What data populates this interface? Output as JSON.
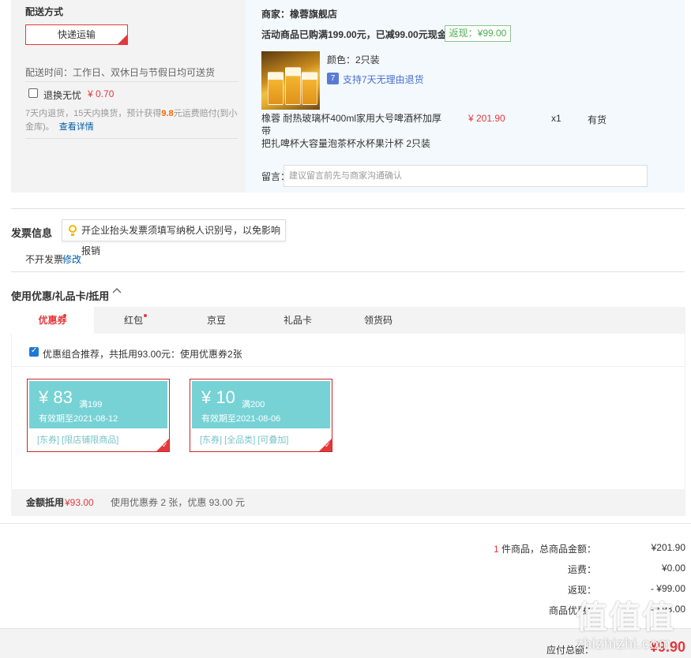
{
  "shipping": {
    "title": "配送方式",
    "method_label": "快递运输",
    "delivery_time": "配送时间：工作日、双休日与节假日均可送货",
    "return_label": "退换无忧",
    "return_price": "¥ 0.70",
    "return_desc_1": "7天内退货，15天内换货，预计获得",
    "return_desc_amount": "9.8",
    "return_desc_2": "元运费赔付(到小",
    "return_desc_3": "金库)。",
    "return_detail_link": "查看详情"
  },
  "shop": {
    "merchant": "商家：橡蓉旗舰店",
    "promo_text": "活动商品已购满199.00元，已减99.00元现金",
    "cashback_badge": "返现：¥99.00",
    "product": {
      "color": "颜色：2只装",
      "return_policy": "支持7天无理由退货",
      "return_icon": "7",
      "title_line1": "橡蓉 耐热玻璃杯400ml家用大号啤酒杯加厚带",
      "title_line2": "把扎啤杯大容量泡茶杯水杯果汁杯 2只装",
      "price": "¥ 201.90",
      "quantity": "x1",
      "stock": "有货"
    },
    "message_label": "留言：",
    "message_placeholder": "建议留言前先与商家沟通确认"
  },
  "invoice": {
    "title": "发票信息",
    "tip": "开企业抬头发票须填写纳税人识别号，以免影响报销",
    "status": "不开发票",
    "edit_link": "修改"
  },
  "discount": {
    "title": "使用优惠/礼品卡/抵用",
    "tabs": [
      {
        "label": "优惠券",
        "active": true,
        "dot": true
      },
      {
        "label": "红包",
        "active": false,
        "dot": true
      },
      {
        "label": "京豆",
        "active": false,
        "dot": false
      },
      {
        "label": "礼品卡",
        "active": false,
        "dot": false
      },
      {
        "label": "领货码",
        "active": false,
        "dot": false
      }
    ],
    "combo_text": "优惠组合推荐，共抵用93.00元：使用优惠券2张",
    "coupons": [
      {
        "symbol": "¥",
        "amount": "83",
        "condition": "满199",
        "expiry": "有效期至2021-08-12",
        "tags": "[东券]  [限店铺限商品]"
      },
      {
        "symbol": "¥",
        "amount": "10",
        "condition": "满200",
        "expiry": "有效期至2021-08-06",
        "tags": "[东券]  [全品类]  [可叠加]"
      }
    ],
    "amount_label": "金额抵用",
    "amount_value": "¥93.00",
    "amount_desc": "使用优惠券 2 张，优惠 93.00 元"
  },
  "summary": {
    "items_count": "1",
    "items_label": " 件商品，总商品金额：",
    "items_total": "¥201.90",
    "shipping_label": "运费：",
    "shipping_value": "¥0.00",
    "cashback_label": "返现：",
    "cashback_value": "- ¥99.00",
    "coupon_label": "商品优惠：",
    "coupon_value": "- ¥93.00",
    "payable_label": "应付总额：",
    "payable_value": "¥9.90"
  },
  "watermark": {
    "main": "值值值",
    "sub": "zhizhizhi.com"
  }
}
